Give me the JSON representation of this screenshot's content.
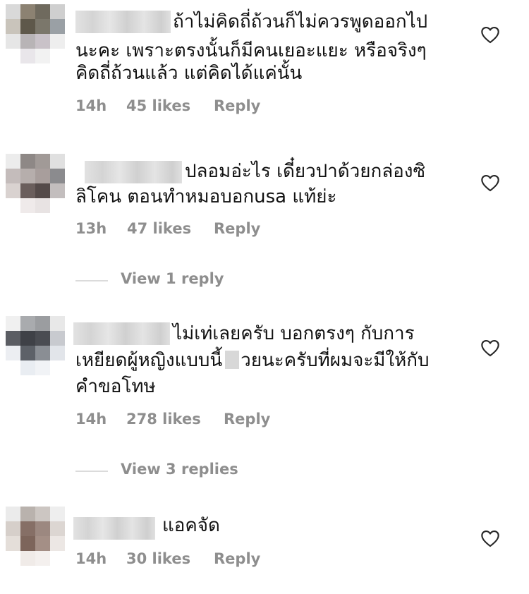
{
  "comments": [
    {
      "lines": [
        "ถ้าไม่คิดถี่ถ้วนก็ไม่ควรพูดออกไป",
        "นะคะ เพราะตรงนั้นก็มีคนเยอะแยะ หรือจริงๆ",
        "คิดถี่ถ้วนแล้ว แต่คิดได้แค่นั้น"
      ],
      "time": "14h",
      "likes": "45 likes",
      "reply_label": "Reply"
    },
    {
      "lines": [
        "ปลอมอ่ะไร เดี๋ยวปาด้วยกล่องซิ",
        "ลิโคน ตอนทำหมอบอกusa แท้ย่ะ"
      ],
      "time": "13h",
      "likes": "47 likes",
      "reply_label": "Reply",
      "view_replies": "View 1 reply"
    },
    {
      "line1": "ไม่เท่เลยครับ บอกตรงๆ กับการ",
      "line2_before": "เหยียดผู้หญิงแบบนี้",
      "line2_after": "วยนะครับที่ผมจะมีให้กับ",
      "line3": "คำขอโทษ",
      "time": "14h",
      "likes": "278 likes",
      "reply_label": "Reply",
      "view_replies": "View 3 replies"
    },
    {
      "lines": [
        "แอคจัด"
      ],
      "time": "14h",
      "likes": "30 likes",
      "reply_label": "Reply"
    }
  ],
  "icons": {
    "like": "heart-outline-icon"
  },
  "colors": {
    "text": "#111111",
    "meta": "#8e8e8e",
    "divider": "#dbdbdb"
  }
}
